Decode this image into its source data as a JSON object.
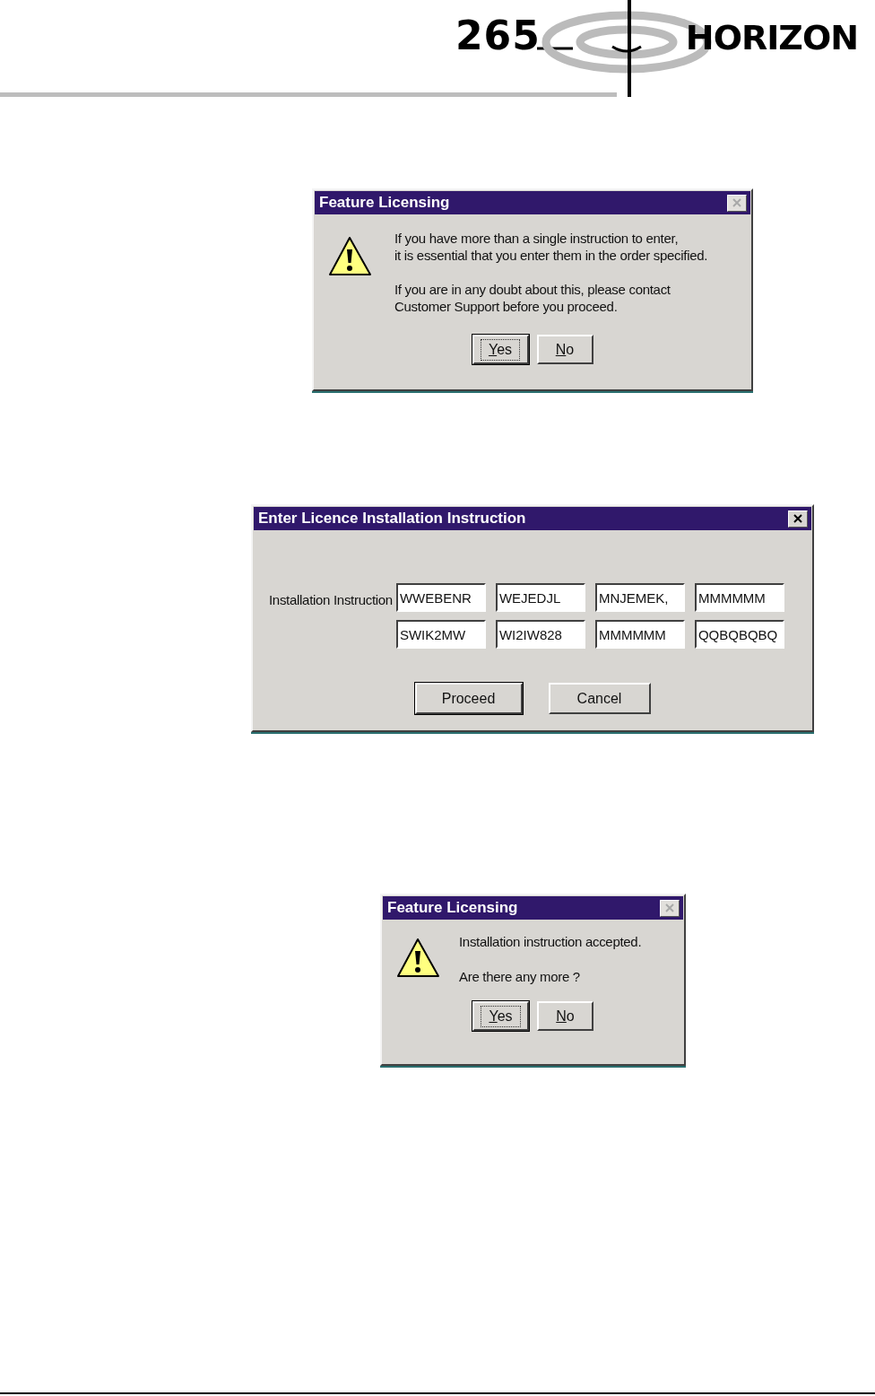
{
  "header": {
    "page_number": "265",
    "brand": "HORIZON"
  },
  "dialogs": [
    {
      "kind": "message",
      "title": "Feature Licensing",
      "close_disabled": true,
      "paragraphs": [
        [
          "If you have more than a single instruction to enter,",
          "it is essential that you enter them in the order specified."
        ],
        [
          "If you are in any doubt about this, please contact",
          "Customer Support before you proceed."
        ]
      ],
      "buttons": [
        {
          "label": "Yes",
          "first_letter_underlined": true,
          "default": true,
          "focused": true
        },
        {
          "label": "No",
          "first_letter_underlined": true,
          "default": false,
          "focused": false
        }
      ]
    },
    {
      "kind": "form",
      "title": "Enter Licence Installation Instruction",
      "close_disabled": false,
      "field_label": "Installation Instruction",
      "fields": [
        "WWEBENR",
        "WEJEDJL",
        "MNJEMEK,",
        "MMMMMM",
        "SWIK2MW",
        "WI2IW828",
        "MMMMMM",
        "QQBQBQBQ"
      ],
      "buttons": [
        {
          "label": "Proceed",
          "default": true,
          "focused": false
        },
        {
          "label": "Cancel",
          "default": false,
          "focused": false
        }
      ]
    },
    {
      "kind": "message",
      "title": "Feature Licensing",
      "close_disabled": true,
      "paragraphs": [
        [
          "Installation instruction accepted."
        ],
        [
          "Are there any more ?"
        ]
      ],
      "buttons": [
        {
          "label": "Yes",
          "first_letter_underlined": true,
          "default": true,
          "focused": true
        },
        {
          "label": "No",
          "first_letter_underlined": true,
          "default": false,
          "focused": false
        }
      ]
    }
  ]
}
